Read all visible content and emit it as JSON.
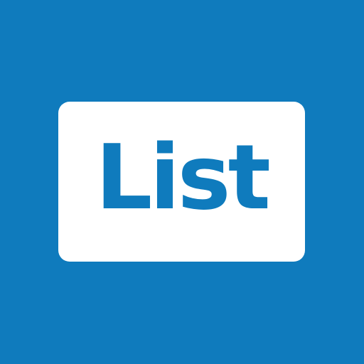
{
  "logo": {
    "text": "List"
  },
  "colors": {
    "background": "#0f7bbd",
    "card": "#ffffff",
    "text": "#0f7bbd"
  }
}
